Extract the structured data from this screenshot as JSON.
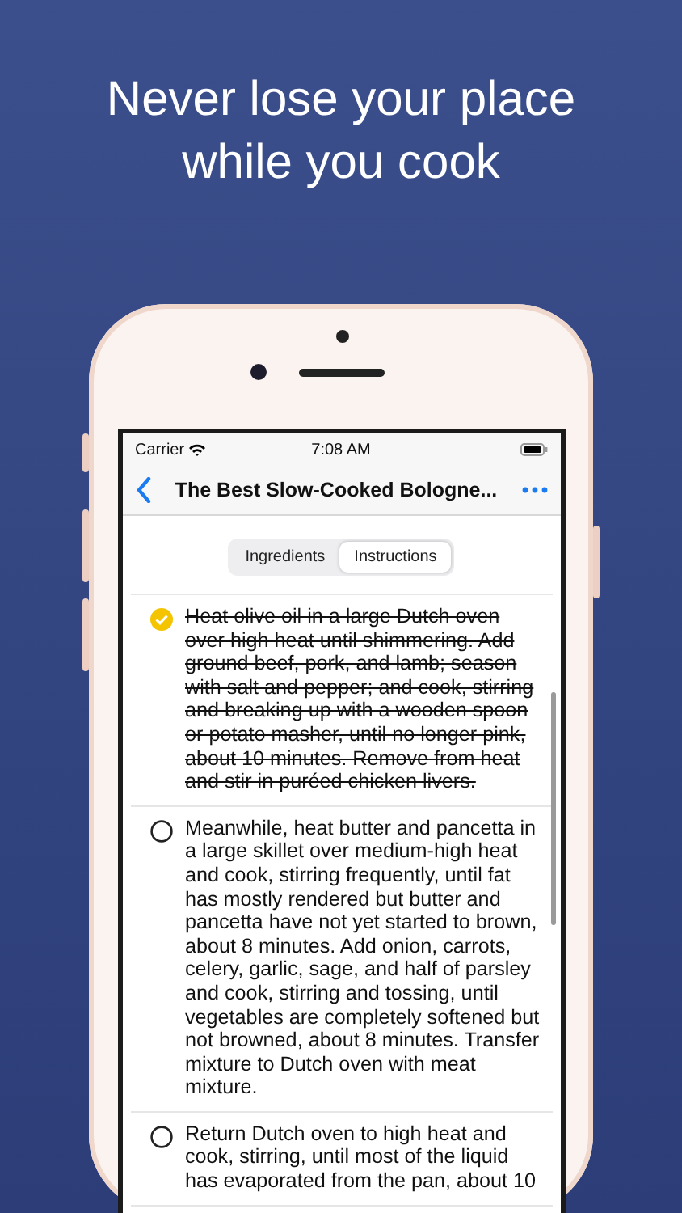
{
  "headline": "Never lose your place while you cook",
  "status_bar": {
    "carrier": "Carrier",
    "time": "7:08 AM"
  },
  "nav": {
    "title": "The Best Slow-Cooked Bologne..."
  },
  "segments": [
    {
      "label": "Ingredients",
      "selected": false
    },
    {
      "label": "Instructions",
      "selected": true
    }
  ],
  "steps": [
    {
      "text": "Heat olive oil in a large Dutch oven over high heat until shimmering. Add ground beef, pork, and lamb; season with salt and pepper; and cook, stirring and breaking up with a wooden spoon or potato masher, until no longer pink, about 10 minutes. Remove from heat and stir in puréed chicken livers.",
      "checked": true
    },
    {
      "text": "Meanwhile, heat butter and pancetta in a large skillet over medium-high heat and cook, stirring frequently, until fat has mostly rendered but butter and pancetta have not yet started to brown, about 8 minutes. Add onion, carrots, celery, garlic, sage, and half of parsley and cook, stirring and tossing, until vegetables are completely softened but not browned, about 8 minutes. Transfer mixture to Dutch oven with meat mixture.",
      "checked": false
    },
    {
      "text": "Return Dutch oven to high heat and cook, stirring, until most of the liquid has evaporated from the pan, about 10",
      "checked": false
    }
  ]
}
